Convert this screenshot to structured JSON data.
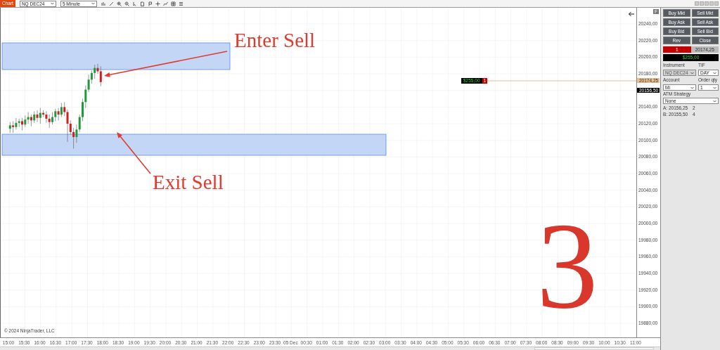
{
  "toolbar": {
    "title": "Chart",
    "instrument": "NQ DEC24",
    "interval": "5 Minute"
  },
  "chart": {
    "flag": "F",
    "copyright": "© 2024 NinjaTrader, LLC",
    "price_axis": [
      {
        "kind": "tick",
        "label": "20240,00"
      },
      {
        "kind": "tick",
        "label": "20220,00"
      },
      {
        "kind": "tick",
        "label": "20200,00"
      },
      {
        "kind": "tick",
        "label": "20180,00"
      },
      {
        "kind": "last",
        "label": "20156,50"
      },
      {
        "kind": "tick",
        "label": "20140,00"
      },
      {
        "kind": "tick",
        "label": "20120,00"
      },
      {
        "kind": "tick",
        "label": "20100,00"
      },
      {
        "kind": "tick",
        "label": "20080,00"
      },
      {
        "kind": "tick",
        "label": "20060,00"
      },
      {
        "kind": "tick",
        "label": "20040,00"
      },
      {
        "kind": "tick",
        "label": "20020,00"
      },
      {
        "kind": "tick",
        "label": "20000,00"
      },
      {
        "kind": "tick",
        "label": "19980,00"
      },
      {
        "kind": "tick",
        "label": "19960,00"
      },
      {
        "kind": "tick",
        "label": "19940,00"
      },
      {
        "kind": "tick",
        "label": "19920,00"
      },
      {
        "kind": "tick",
        "label": "19900,00"
      },
      {
        "kind": "tick",
        "label": "19880,00"
      }
    ],
    "entry_marker": "20174,25",
    "position_marker": {
      "pnl": "$255,00",
      "qty": "1"
    },
    "time_axis": [
      "15:00",
      "15:30",
      "16:00",
      "16:30",
      "17:00",
      "17:30",
      "18:00",
      "18:30",
      "19:00",
      "19:30",
      "20:00",
      "20:30",
      "21:00",
      "21:30",
      "22:00",
      "22:30",
      "23:00",
      "23:30",
      "05 Dec",
      "00:30",
      "01:00",
      "01:30",
      "02:00",
      "02:30",
      "03:00",
      "03:30",
      "04:00",
      "04:30",
      "05:00",
      "05:30",
      "06:00",
      "06:30",
      "07:00",
      "07:30",
      "08:00",
      "08:30",
      "09:00",
      "09:30",
      "10:00",
      "10:30",
      "11:00"
    ],
    "annotations": [
      {
        "text": "Enter Sell"
      },
      {
        "text": "Exit Sell"
      }
    ],
    "step": "3"
  },
  "panel": {
    "buttons": [
      "Buy Mkt",
      "Sell Mkt",
      "Buy Ask",
      "Sell Ask",
      "Buy Bid",
      "Sell Bid",
      "Rev",
      "Close"
    ],
    "position": {
      "qty": "1",
      "price": "20174,25",
      "pnl": "$255,00"
    },
    "instrument_label": "Instrument",
    "instrument": "NQ DEC24",
    "instrument_disabled": true,
    "tif_label": "TIF",
    "tif": "DAY",
    "account_label": "Account",
    "account": "Mi",
    "qty_label": "Order qty",
    "qty": "1",
    "atm_label": "ATM Strategy",
    "atm": "None",
    "quotes": [
      {
        "side": "A:",
        "price": "20156,25",
        "size": "2"
      },
      {
        "side": "B:",
        "price": "20155,50",
        "size": "4"
      }
    ]
  }
}
